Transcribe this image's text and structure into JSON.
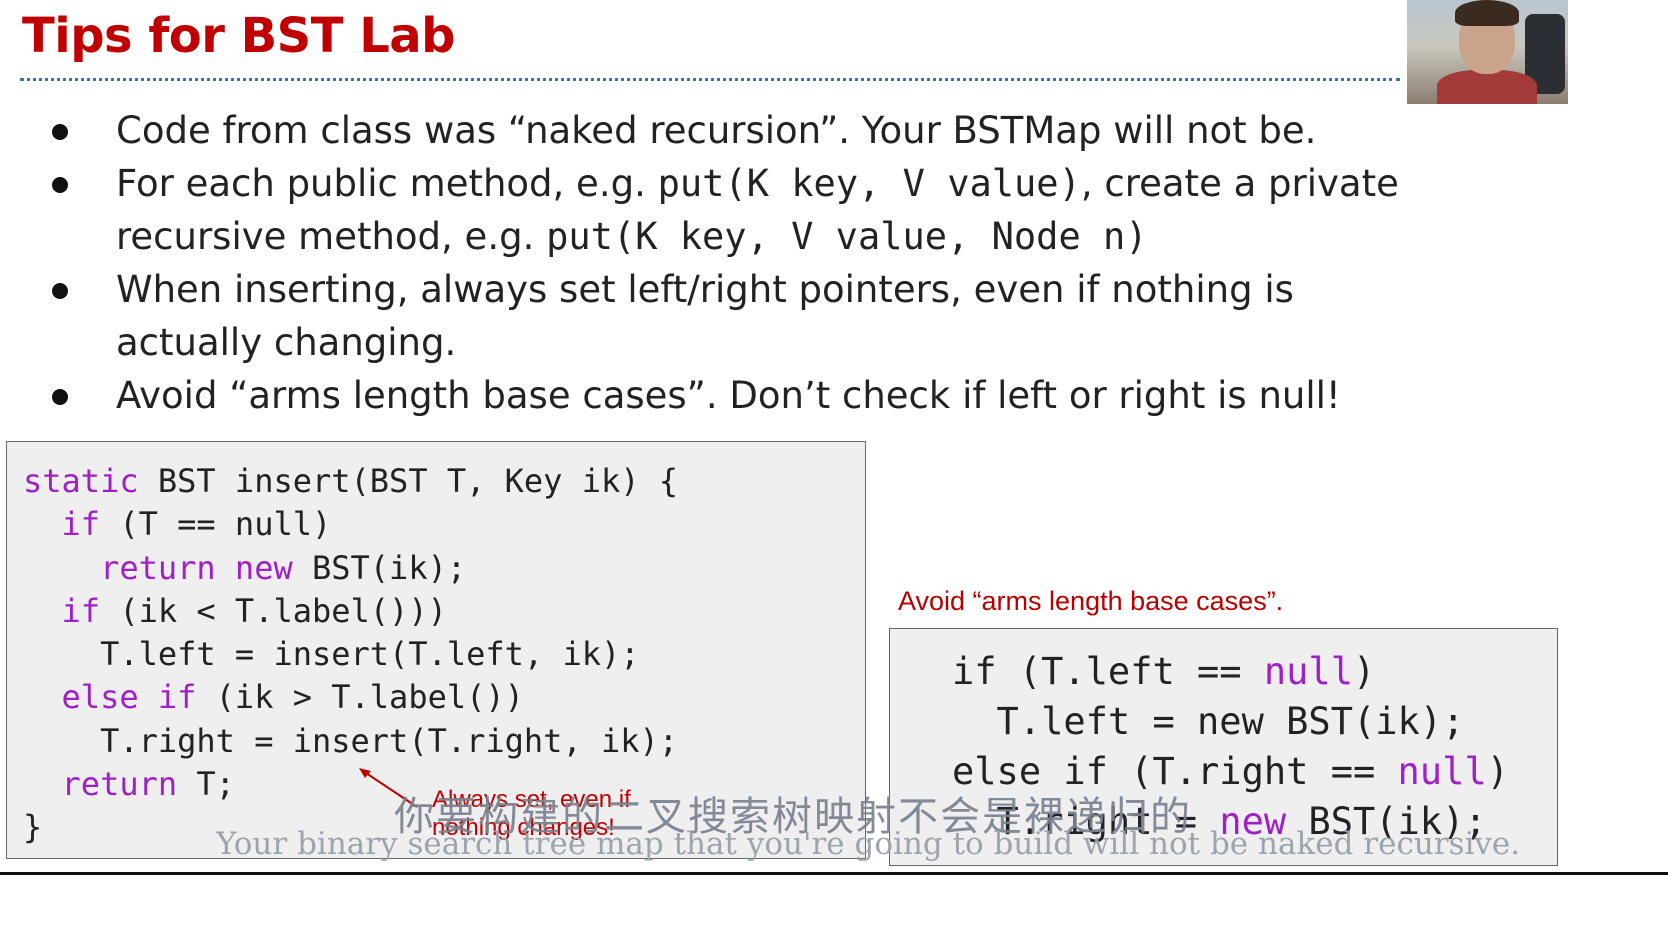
{
  "slide": {
    "title": "Tips for BST Lab",
    "bullets": [
      {
        "text": "Code from class was “naked recursion”. Your BSTMap will not be."
      },
      {
        "pre": "For each public method, e.g. ",
        "code1": "put(K key, V value)",
        "mid": ", create a private recursive method, e.g. ",
        "code2": "put(K key, V value, Node n)"
      },
      {
        "text": "When inserting, always set left/right pointers, even if nothing is actually changing."
      },
      {
        "text": "Avoid “arms length base cases”. Don’t check if left or right is null!"
      }
    ]
  },
  "code_left": {
    "lines": [
      {
        "kw": "static",
        "rest": " BST insert(BST T, Key ik) {"
      },
      {
        "indent": "  ",
        "kw": "if",
        "rest": " (T == null)"
      },
      {
        "indent": "    ",
        "kw": "return new",
        "rest": " BST(ik);"
      },
      {
        "indent": "  ",
        "kw": "if",
        "rest": " (ik < T.label()))"
      },
      {
        "indent": "    ",
        "kw": "",
        "rest": "T.left = insert(T.left, ik);"
      },
      {
        "indent": "  ",
        "kw": "else if",
        "rest": " (ik > T.label())"
      },
      {
        "indent": "    ",
        "kw": "",
        "rest": "T.right = insert(T.right, ik);"
      },
      {
        "indent": "  ",
        "kw": "return",
        "rest": " T;"
      },
      {
        "indent": "",
        "kw": "",
        "rest": "}"
      }
    ],
    "annotation_line1": "Always set, even if",
    "annotation_line2": "nothing changes!"
  },
  "code_right": {
    "note": "Avoid “arms length base cases”.",
    "l1_pre": "if (T.left == ",
    "l1_kw": "null",
    "l1_post": ")",
    "l2": "  T.left = new BST(ik);",
    "l3_pre": "else if (T.right == ",
    "l3_kw": "null",
    "l3_post": ")",
    "l4_pre": "  T.right = ",
    "l4_kw": "new",
    "l4_post": " BST(ik);"
  },
  "subtitles": {
    "chinese": "你要构建的二叉搜索树映射不会是裸递归的",
    "english": "Your binary search tree map that you're going to build will not be naked recursive."
  },
  "colors": {
    "title": "#c00000",
    "keyword": "#a020c8",
    "annotation": "#c00000",
    "divider": "#3a6fb0"
  }
}
